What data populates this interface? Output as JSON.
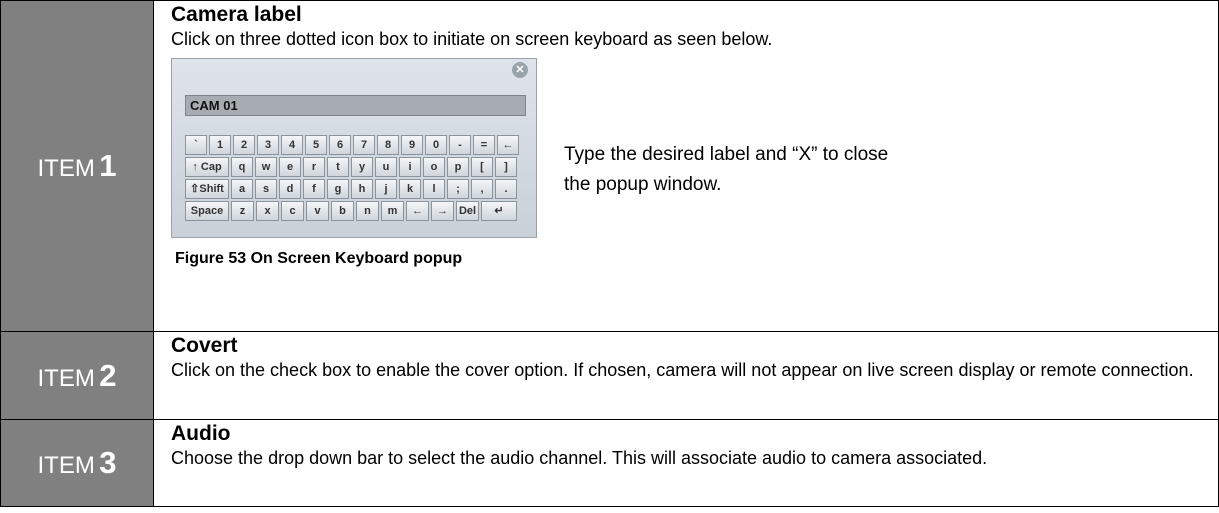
{
  "items": [
    {
      "label": "ITEM",
      "number": "1",
      "heading": "Camera label",
      "body": "Click on three dotted icon box to initiate on screen keyboard as seen below.",
      "side_text": "Type the desired label and “X” to close the popup window.",
      "caption": "Figure 53 On Screen Keyboard popup"
    },
    {
      "label": "ITEM",
      "number": "2",
      "heading": "Covert",
      "body": "Click on the check box to enable the cover option. If chosen, camera will not appear on live screen display or remote connection."
    },
    {
      "label": "ITEM",
      "number": "3",
      "heading": "Audio",
      "body": "Choose the drop down bar to select the audio channel. This will associate audio to camera associated."
    }
  ],
  "keyboard": {
    "field_value": "CAM 01",
    "close_icon": "close-icon",
    "rows": [
      [
        "`",
        "1",
        "2",
        "3",
        "4",
        "5",
        "6",
        "7",
        "8",
        "9",
        "0",
        "-",
        "=",
        "←"
      ],
      [
        "↑ Cap",
        "q",
        "w",
        "e",
        "r",
        "t",
        "y",
        "u",
        "i",
        "o",
        "p",
        "[",
        "]"
      ],
      [
        "⇧Shift",
        "a",
        "s",
        "d",
        "f",
        "g",
        "h",
        "j",
        "k",
        "l",
        ";",
        ",",
        "."
      ],
      [
        "Space",
        "z",
        "x",
        "c",
        "v",
        "b",
        "n",
        "m",
        "←",
        "→",
        "Del",
        "↵"
      ]
    ]
  }
}
